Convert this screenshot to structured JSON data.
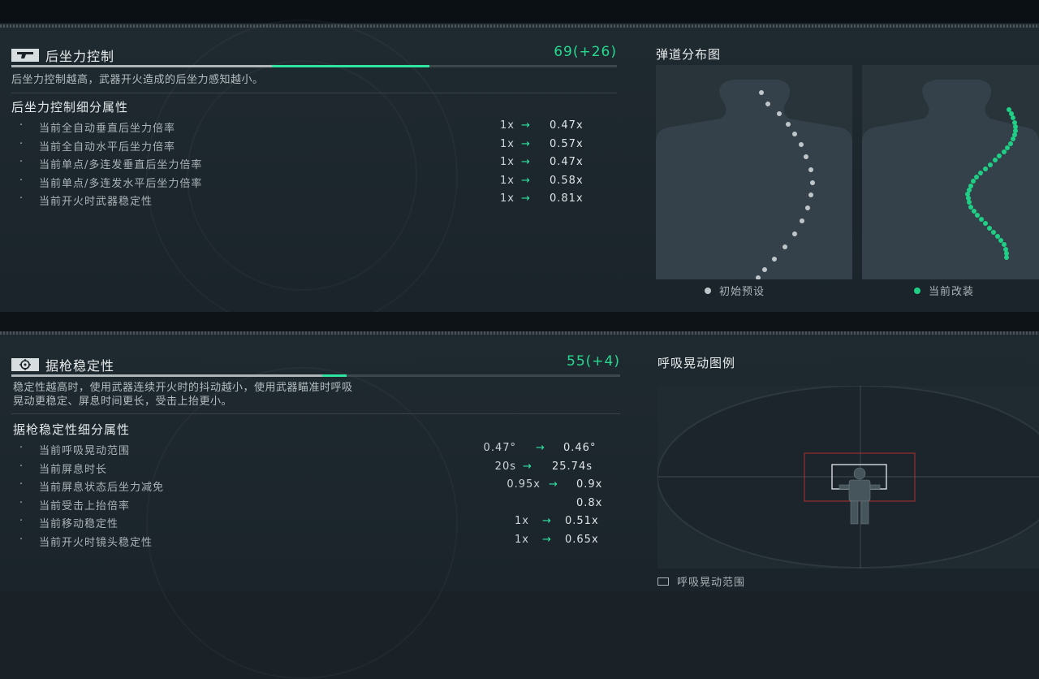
{
  "recoil": {
    "icon": "pistol-icon",
    "title": "后坐力控制",
    "score": "69(+26)",
    "base_fraction": 0.43,
    "gain_fraction": 0.26,
    "description": "后坐力控制越高，武器开火造成的后坐力感知越小。",
    "subtitle": "后坐力控制细分属性",
    "stats": [
      {
        "bullet": "·",
        "label": "当前全自动垂直后坐力倍率",
        "from": "1x",
        "arrow": "→",
        "to": "0.47x"
      },
      {
        "bullet": "·",
        "label": "当前全自动水平后坐力倍率",
        "from": "1x",
        "arrow": "→",
        "to": "0.57x"
      },
      {
        "bullet": "·",
        "label": "当前单点/多连发垂直后坐力倍率",
        "from": "1x",
        "arrow": "→",
        "to": "0.47x"
      },
      {
        "bullet": "·",
        "label": "当前单点/多连发水平后坐力倍率",
        "from": "1x",
        "arrow": "→",
        "to": "0.58x"
      },
      {
        "bullet": "·",
        "label": "当前开火时武器稳定性",
        "from": "1x",
        "arrow": "→",
        "to": "0.81x"
      }
    ],
    "chart": {
      "title": "弹道分布图",
      "legend_default": "初始预设",
      "legend_current": "当前改装",
      "default_color": "#bfc6c9",
      "current_color": "#1fcf85"
    }
  },
  "stability": {
    "icon": "crosshair-icon",
    "title": "据枪稳定性",
    "score": "55(+4)",
    "base_fraction": 0.51,
    "gain_fraction": 0.04,
    "description_line1": "稳定性越高时，使用武器连续开火时的抖动越小，使用武器瞄准时呼吸",
    "description_line2": "晃动更稳定、屏息时间更长，受击上抬更小。",
    "subtitle": "据枪稳定性细分属性",
    "stats": [
      {
        "bullet": "·",
        "label": "当前呼吸晃动范围",
        "from": "0.47°",
        "arrow": "→",
        "to": "0.46°"
      },
      {
        "bullet": "·",
        "label": "当前屏息时长",
        "from": "20s",
        "arrow": "→",
        "to": "25.74s"
      },
      {
        "bullet": "·",
        "label": "当前屏息状态后坐力减免",
        "from": "0.95x",
        "arrow": "→",
        "to": "0.9x"
      },
      {
        "bullet": "·",
        "label": "当前受击上抬倍率",
        "from": "",
        "arrow": "",
        "to": "0.8x"
      },
      {
        "bullet": "·",
        "label": "当前移动稳定性",
        "from": "1x",
        "arrow": "→",
        "to": "0.51x"
      },
      {
        "bullet": "·",
        "label": "当前开火时镜头稳定性",
        "from": "1x",
        "arrow": "→",
        "to": "0.65x"
      }
    ],
    "illustration": {
      "title": "呼吸晃动图例",
      "legend": "呼吸晃动范围",
      "range_color": "#b3302c"
    }
  }
}
